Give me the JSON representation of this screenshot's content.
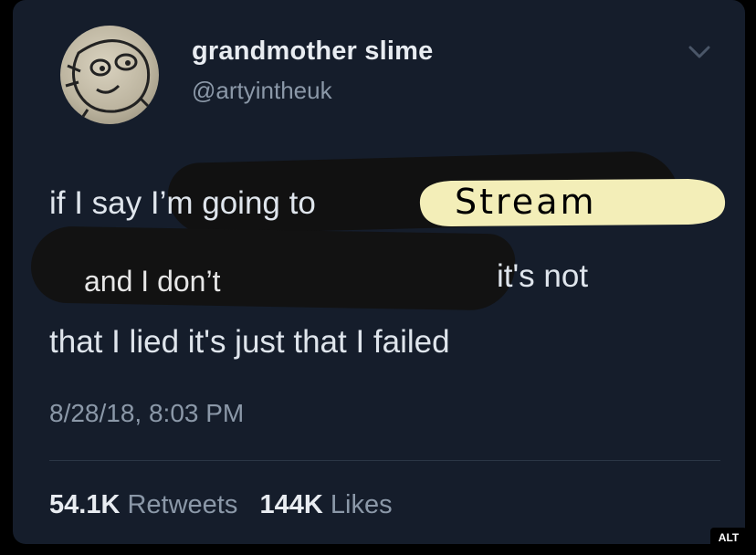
{
  "tweet": {
    "author": {
      "display_name": "grandmother slime",
      "handle": "@artyintheuk",
      "avatar_icon": "cartoon-creature-avatar"
    },
    "menu_icon": "chevron-down-icon",
    "text": {
      "line1": "if I say I’m going to",
      "scribble_word": "Stream",
      "line2a": "and I don’t",
      "line2b": "it's not",
      "line3": "that I lied it's just that I failed"
    },
    "timestamp": "8/28/18, 8:03 PM",
    "stats": {
      "retweets_count": "54.1K",
      "retweets_label": "Retweets",
      "likes_count": "144K",
      "likes_label": "Likes"
    }
  },
  "alt_badge": "ALT",
  "colors": {
    "card_bg": "#151d2b",
    "redaction": "#111111",
    "highlight": "#f3eeb8",
    "secondary_text": "#8b98a8"
  }
}
